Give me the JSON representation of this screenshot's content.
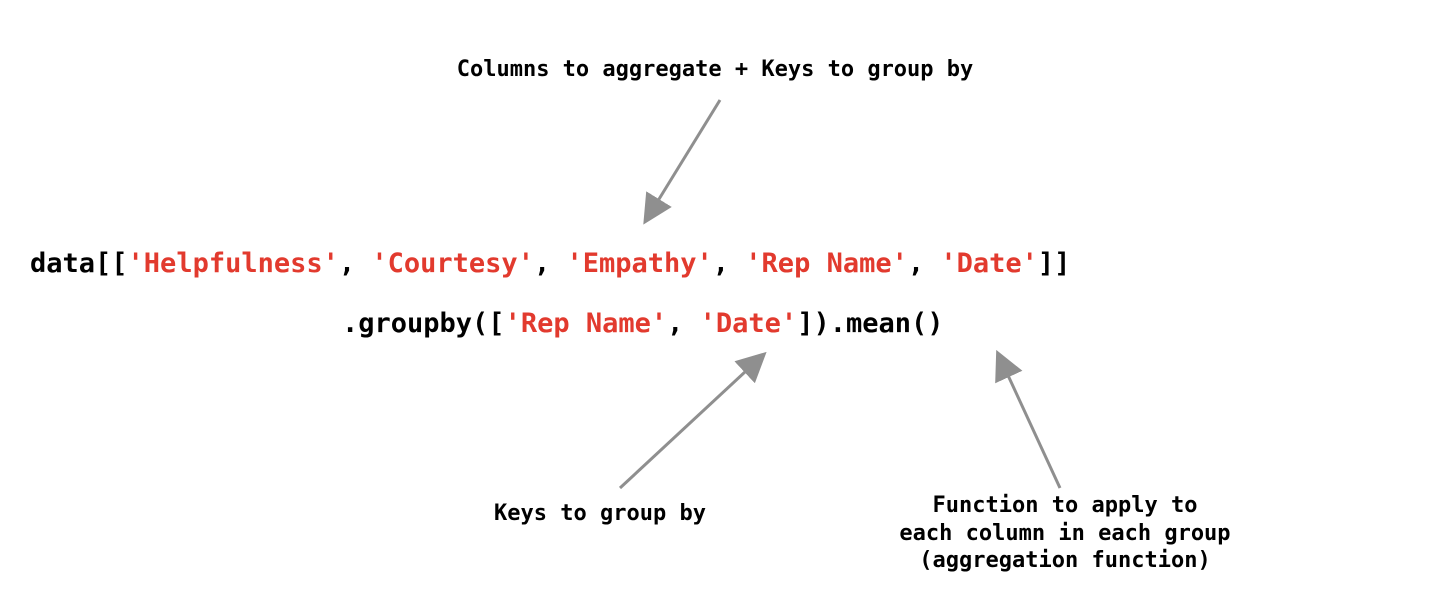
{
  "labels": {
    "top": "Columns to aggregate + Keys to group by",
    "bottomLeft": "Keys to group by",
    "bottomRight": "Function to apply to\neach column in each group\n(aggregation function)"
  },
  "code": {
    "line1": {
      "part1": "data[[",
      "str1": "'Helpfulness'",
      "sep1": ", ",
      "str2": "'Courtesy'",
      "sep2": ", ",
      "str3": "'Empathy'",
      "sep3": ", ",
      "str4": "'Rep Name'",
      "sep4": ", ",
      "str5": "'Date'",
      "part2": "]]"
    },
    "line2": {
      "part1": ".groupby([",
      "str1": "'Rep Name'",
      "sep1": ", ",
      "str2": "'Date'",
      "part2": "]).mean()"
    }
  },
  "colors": {
    "arrow": "#8f8f8f",
    "keyword": "#e23a2e",
    "text": "#000000",
    "background": "#ffffff"
  }
}
